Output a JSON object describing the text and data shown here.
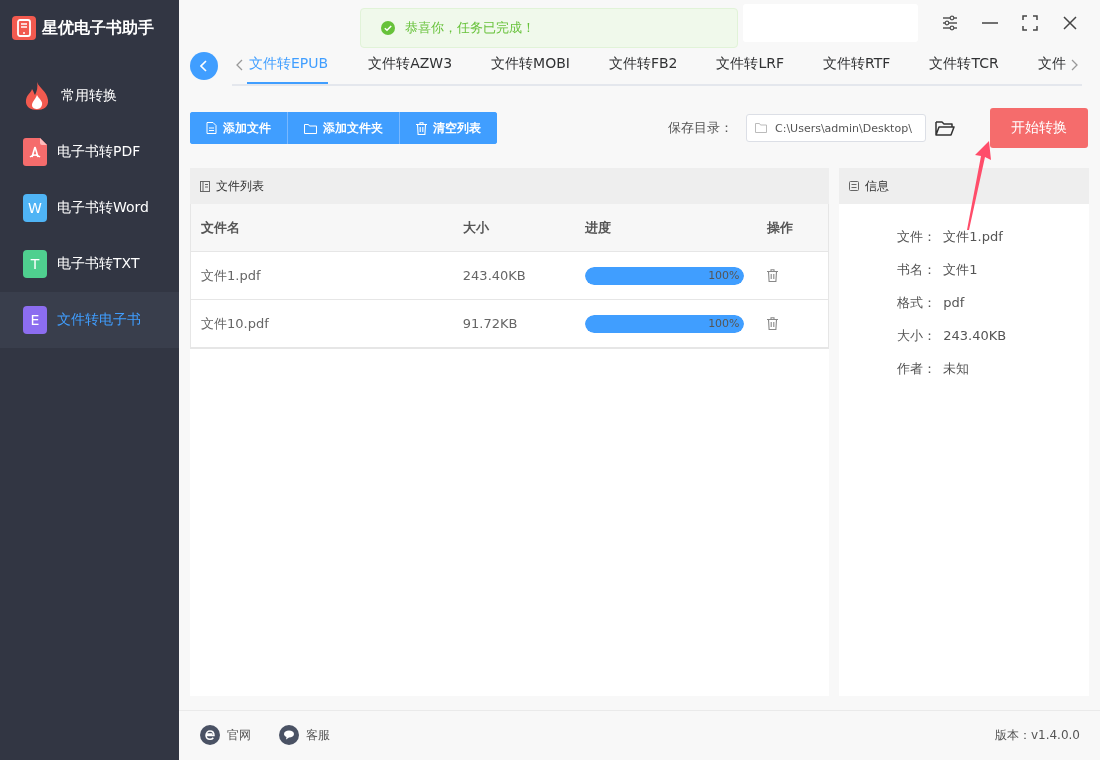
{
  "app": {
    "title": "星优电子书助手"
  },
  "sidebar": {
    "items": [
      {
        "label": "常用转换",
        "kind": "fire",
        "selected": false
      },
      {
        "label": "电子书转PDF",
        "kind": "pdf",
        "selected": false
      },
      {
        "label": "电子书转Word",
        "kind": "word",
        "icon_letter": "W",
        "selected": false
      },
      {
        "label": "电子书转TXT",
        "kind": "txt",
        "icon_letter": "T",
        "selected": false
      },
      {
        "label": "文件转电子书",
        "kind": "ebook",
        "icon_letter": "E",
        "selected": true
      }
    ]
  },
  "tabs": [
    {
      "label": "文件转EPUB",
      "selected": true
    },
    {
      "label": "文件转AZW3",
      "selected": false
    },
    {
      "label": "文件转MOBI",
      "selected": false
    },
    {
      "label": "文件转FB2",
      "selected": false
    },
    {
      "label": "文件转LRF",
      "selected": false
    },
    {
      "label": "文件转RTF",
      "selected": false
    },
    {
      "label": "文件转TCR",
      "selected": false
    },
    {
      "label": "文件",
      "selected": false
    }
  ],
  "toast": {
    "message": "恭喜你，任务已完成！"
  },
  "toolbar": {
    "buttons": [
      {
        "label": "添加文件",
        "kind": "file"
      },
      {
        "label": "添加文件夹",
        "kind": "folder"
      },
      {
        "label": "清空列表",
        "kind": "trash"
      }
    ],
    "save_label": "保存目录：",
    "save_path": "C:\\Users\\admin\\Desktop\\",
    "start_button": "开始转换"
  },
  "file_list": {
    "title": "文件列表",
    "columns": [
      "文件名",
      "大小",
      "进度",
      "操作"
    ],
    "rows": [
      {
        "name": "文件1.pdf",
        "size": "243.40KB",
        "level": 1,
        "reading": "100%"
      },
      {
        "name": "文件10.pdf",
        "size": "91.72KB",
        "level": 1,
        "reading": "100%"
      }
    ]
  },
  "info": {
    "title": "信息",
    "fields": [
      {
        "label": "文件：",
        "value": "文件1.pdf"
      },
      {
        "label": "书名：",
        "value": "文件1"
      },
      {
        "label": "格式：",
        "value": "pdf"
      },
      {
        "label": "大小：",
        "value": "243.40KB"
      },
      {
        "label": "作者：",
        "value": "未知"
      }
    ]
  },
  "footer": {
    "links": [
      {
        "label": "官网",
        "kind": "web"
      },
      {
        "label": "客服",
        "kind": "chat"
      }
    ],
    "version": "版本：v1.4.0.0"
  }
}
